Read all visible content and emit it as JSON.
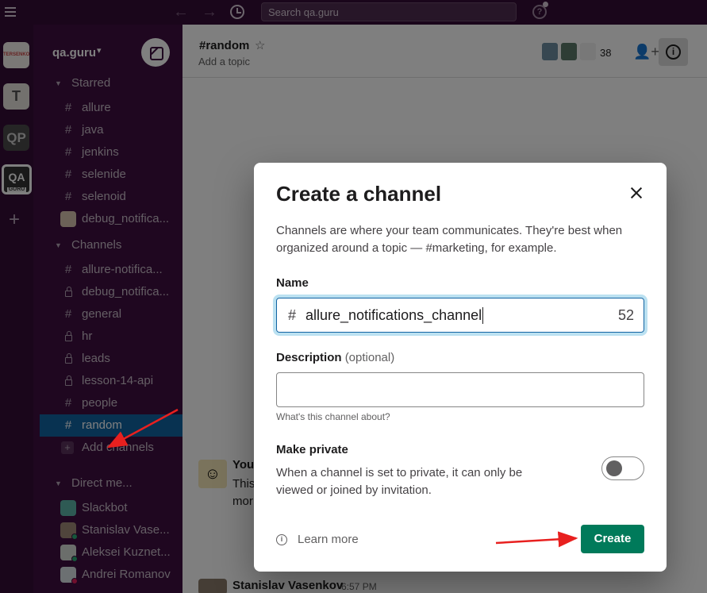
{
  "topbar": {
    "search_placeholder": "Search qa.guru",
    "back_icon": "←",
    "forward_icon": "→",
    "help_icon": "?"
  },
  "rail": {
    "workspaces": [
      "TERSENKOV",
      "T",
      "QP",
      "QA",
      "GURU"
    ],
    "add_icon": "+"
  },
  "sidebar": {
    "workspace_name": "qa.guru",
    "caret": "⌄",
    "starred_header": "Starred",
    "starred": [
      "allure",
      "java",
      "jenkins",
      "selenide",
      "selenoid",
      "debug_notifica..."
    ],
    "channels_header": "Channels",
    "channels": [
      "allure-notifica...",
      "debug_notifica...",
      "general",
      "hr",
      "leads",
      "lesson-14-api",
      "people",
      "random"
    ],
    "add_channels": "Add channels",
    "dm_header": "Direct me...",
    "dms": [
      "Slackbot",
      "Stanislav Vase...",
      "Aleksei Kuznet...",
      "Andrei Romanov"
    ],
    "hash": "#",
    "plus": "+"
  },
  "channel": {
    "name": "#random",
    "star_icon": "☆",
    "topic": "Add a topic",
    "member_count": "38",
    "add_member_icon": "👤+",
    "info_icon": "i"
  },
  "messages": {
    "emoji": "☺",
    "partial_title": "You",
    "partial_line1": "This",
    "partial_line2": "mor",
    "author": "Stanislav Vasenkov",
    "time": "6:57 PM"
  },
  "modal": {
    "title": "Create a channel",
    "description": "Channels are where your team communicates. They're best when organized around a topic — #marketing, for example.",
    "name_label": "Name",
    "name_prefix": "#",
    "name_value": "allure_notifications_channel",
    "name_remaining": "52",
    "description_label": "Description",
    "description_optional": "(optional)",
    "description_value": "",
    "description_hint": "What's this channel about?",
    "private_label": "Make private",
    "private_text": "When a channel is set to private, it can only be viewed or joined by invitation.",
    "private_enabled": false,
    "learn_more": "Learn more",
    "learn_icon": "i",
    "create_label": "Create"
  },
  "colors": {
    "sidebar": "#3f0e40",
    "active": "#1164a3",
    "create": "#007a5a",
    "annotation": "#e8201f"
  }
}
